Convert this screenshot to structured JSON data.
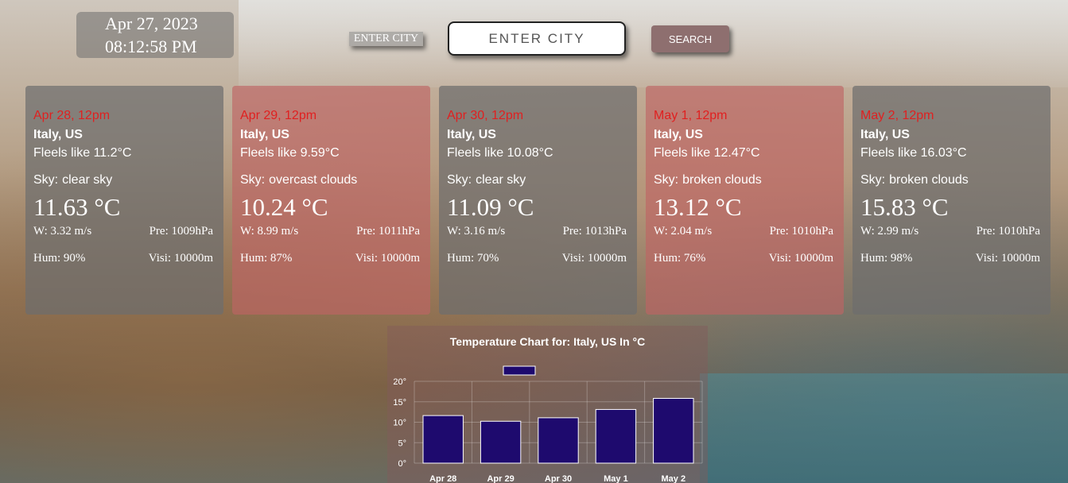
{
  "clock": {
    "date": "Apr 27, 2023",
    "time": "08:12:58 PM"
  },
  "search": {
    "label": "ENTER CITY",
    "placeholder": "ENTER CITY",
    "button_label": "SEARCH"
  },
  "labels": {
    "sky": "Sky:"
  },
  "cards": [
    {
      "date": "Apr 28, 12pm",
      "location": "Italy, US",
      "feels": "Fleels like 11.2°C",
      "sky": "clear sky",
      "temp": "11.63 °C",
      "wind": "W: 3.32 m/s",
      "pressure": "Pre: 1009hPa",
      "humidity": "Hum: 90%",
      "visibility": "Visi: 10000m",
      "tint": "gray"
    },
    {
      "date": "Apr 29, 12pm",
      "location": "Italy, US",
      "feels": "Fleels like 9.59°C",
      "sky": "overcast clouds",
      "temp": "10.24 °C",
      "wind": "W: 8.99 m/s",
      "pressure": "Pre: 1011hPa",
      "humidity": "Hum: 87%",
      "visibility": "Visi: 10000m",
      "tint": "red"
    },
    {
      "date": "Apr 30, 12pm",
      "location": "Italy, US",
      "feels": "Fleels like 10.08°C",
      "sky": "clear sky",
      "temp": "11.09 °C",
      "wind": "W: 3.16 m/s",
      "pressure": "Pre: 1013hPa",
      "humidity": "Hum: 70%",
      "visibility": "Visi: 10000m",
      "tint": "gray"
    },
    {
      "date": "May 1, 12pm",
      "location": "Italy, US",
      "feels": "Fleels like 12.47°C",
      "sky": "broken clouds",
      "temp": "13.12 °C",
      "wind": "W: 2.04 m/s",
      "pressure": "Pre: 1010hPa",
      "humidity": "Hum: 76%",
      "visibility": "Visi: 10000m",
      "tint": "red"
    },
    {
      "date": "May 2, 12pm",
      "location": "Italy, US",
      "feels": "Fleels like 16.03°C",
      "sky": "broken clouds",
      "temp": "15.83 °C",
      "wind": "W: 2.99 m/s",
      "pressure": "Pre: 1010hPa",
      "humidity": "Hum: 98%",
      "visibility": "Visi: 10000m",
      "tint": "gray"
    }
  ],
  "chart_data": {
    "type": "bar",
    "title": "Temperature Chart for: Italy, US In °C",
    "categories": [
      "Apr 28",
      "Apr 29",
      "Apr 30",
      "May 1",
      "May 2"
    ],
    "values": [
      11.63,
      10.24,
      11.09,
      13.12,
      15.83
    ],
    "ylim": [
      0,
      20
    ],
    "yticks": [
      "0°",
      "5°",
      "10°",
      "15°",
      "20°"
    ],
    "grid": true,
    "legend": "top",
    "bar_color": "#1e0a6e",
    "bar_border": "#ffffff"
  }
}
